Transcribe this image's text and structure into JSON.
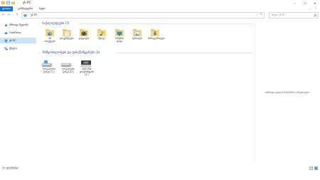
{
  "window": {
    "title": "ეს PC",
    "minimize": "–",
    "maximize": "☐",
    "close": "✕"
  },
  "ribbon": {
    "tabs": [
      {
        "label": "ფაილი",
        "active": true
      },
      {
        "label": "კომპიუტერი",
        "active": false
      },
      {
        "label": "ხედი",
        "active": false
      }
    ],
    "collapse": "⌄",
    "help": "?"
  },
  "address": {
    "back": "←",
    "forward": "→",
    "recent": "⌄",
    "up": "↑",
    "path": "ეს PC",
    "separator": "›",
    "dropdown": "⌄",
    "refresh": "↻",
    "search_placeholder": "ძიება: ეს PC"
  },
  "sidebar": {
    "items": [
      {
        "label": "სწრაფი წვდომა",
        "icon": "star-icon",
        "color": "#2b7cd3"
      },
      {
        "label": "OneDrive",
        "icon": "cloud-icon",
        "color": "#2b7cd3"
      },
      {
        "label": "ეს PC",
        "icon": "pc-icon",
        "color": "#2b7cd3",
        "selected": true
      },
      {
        "label": "ქსელი",
        "icon": "network-icon",
        "color": "#2b7cd3"
      }
    ]
  },
  "folders_group": {
    "header": "საქაღალდეები (7)",
    "items": [
      {
        "label": "3D ობიექტები",
        "icon": "3d-objects-icon",
        "accent": "#5aa0d8"
      },
      {
        "label": "დოკუმენტები",
        "icon": "documents-icon",
        "accent": "#9aa7b2"
      },
      {
        "label": "ვიდეოები",
        "icon": "videos-icon",
        "accent": "#4a5563"
      },
      {
        "label": "მუსიკა",
        "icon": "music-icon",
        "accent": "#1f6fbf"
      },
      {
        "label": "სამუშაო დაფა",
        "icon": "desktop-icon",
        "accent": "#2b8fe0"
      },
      {
        "label": "სურათები",
        "icon": "pictures-icon",
        "accent": "#6a98c9"
      },
      {
        "label": "ჩამოტვირთვები",
        "icon": "downloads-icon",
        "accent": "#1f7ad6"
      }
    ]
  },
  "drives_group": {
    "header": "მოწყობილობები და დისკწამყვანები (3)",
    "items": [
      {
        "label": "ლოკალური დისკი (C:)",
        "icon": "local-disk-icon"
      },
      {
        "label": "ლოკალური დისკი (D:)",
        "icon": "local-disk-icon"
      },
      {
        "label": "DVD RW დისკწამყვანი (E:)",
        "icon": "dvd-drive-icon"
      }
    ]
  },
  "details": {
    "message": "აირჩიეთ ფაილი წინასწარი ნახვისთვის."
  },
  "status": {
    "text": "10 ელემენტი"
  }
}
